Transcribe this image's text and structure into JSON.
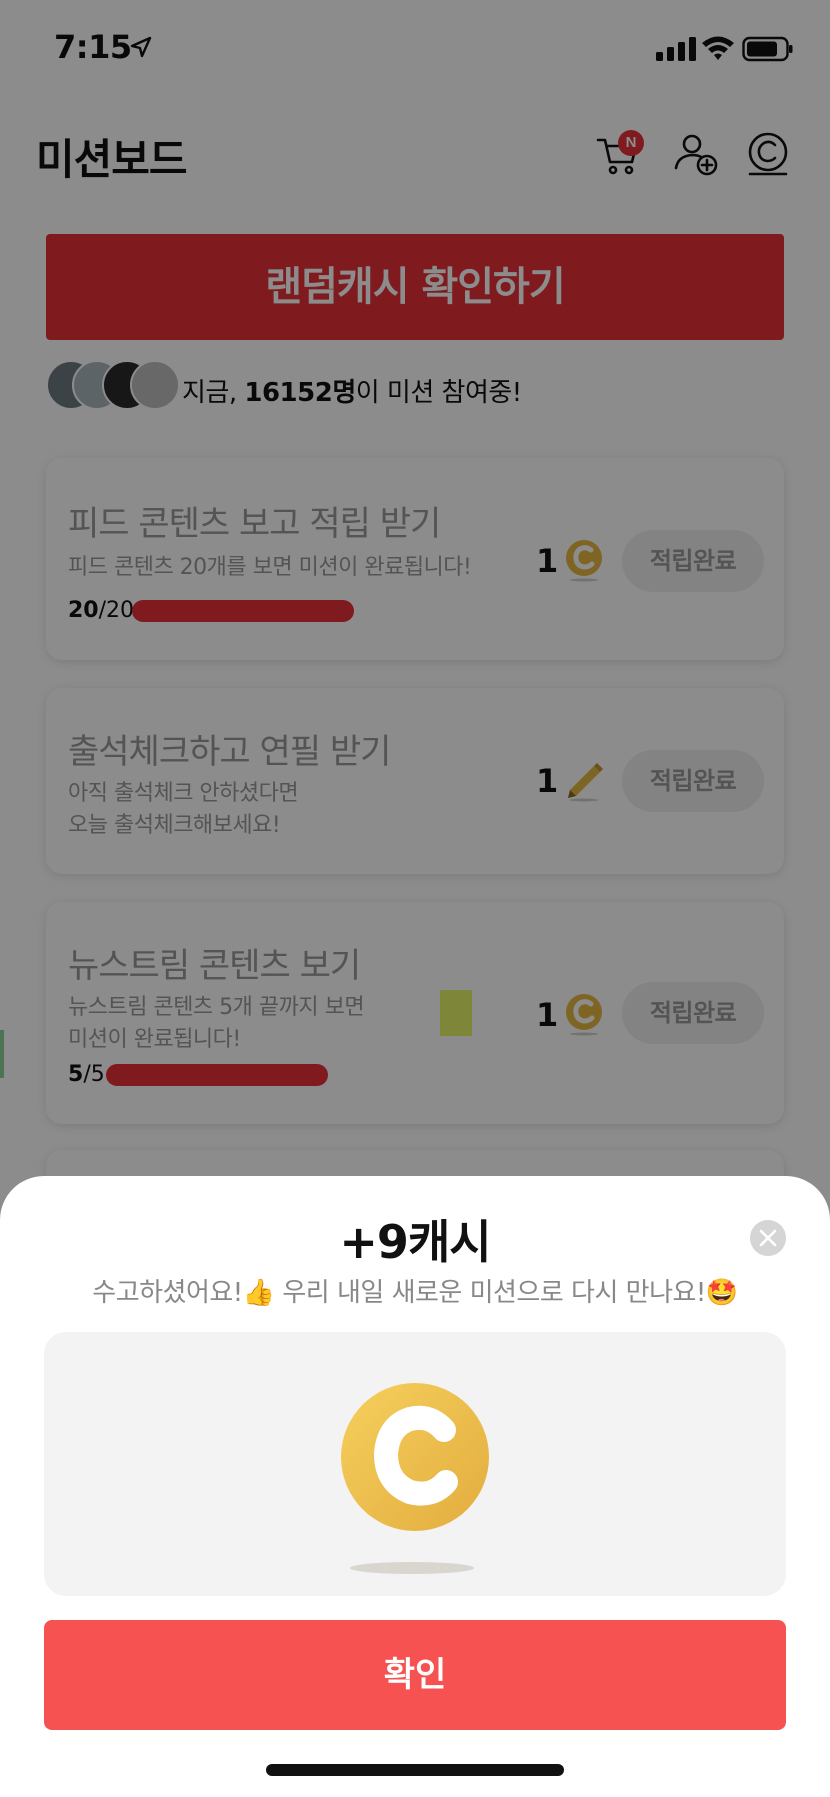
{
  "status_bar": {
    "time": "7:15"
  },
  "header": {
    "title": "미션보드",
    "cart_badge": "N"
  },
  "random_cash": {
    "label": "랜덤캐시 확인하기"
  },
  "participants": {
    "prefix": "지금, ",
    "count": "16152명",
    "suffix": "이 미션 참여중!"
  },
  "missions": [
    {
      "title": "피드 콘텐츠 보고 적립 받기",
      "desc_lines": [
        "피드 콘텐츠 20개를 보면 미션이 완료됩니다!"
      ],
      "progress_current": "20",
      "progress_total": "/20",
      "progress_fraction": 1.0,
      "reward_amount": "1",
      "reward_icon": "coin-icon",
      "button_label": "적립완료"
    },
    {
      "title": "출석체크하고 연필 받기",
      "desc_lines": [
        "아직 출석체크 안하셨다면",
        "오늘 출석체크해보세요!"
      ],
      "reward_amount": "1",
      "reward_icon": "pencil-icon",
      "button_label": "적립완료"
    },
    {
      "title": "뉴스트림 콘텐츠 보기",
      "desc_lines": [
        "뉴스트림 콘텐츠 5개 끝까지 보면",
        "미션이 완료됩니다!"
      ],
      "progress_current": "5",
      "progress_total": "/5",
      "progress_fraction": 1.0,
      "reward_amount": "1",
      "reward_icon": "coin-icon",
      "button_label": "적립완료"
    }
  ],
  "sheet": {
    "title": "+9캐시",
    "subtitle": "수고하셨어요!👍 우리 내일 새로운 미션으로 다시 만나요!🤩",
    "confirm_label": "확인"
  },
  "colors": {
    "brand_red": "#e8323a",
    "confirm_red": "#f75252",
    "coin_gold": "#f0c050"
  }
}
